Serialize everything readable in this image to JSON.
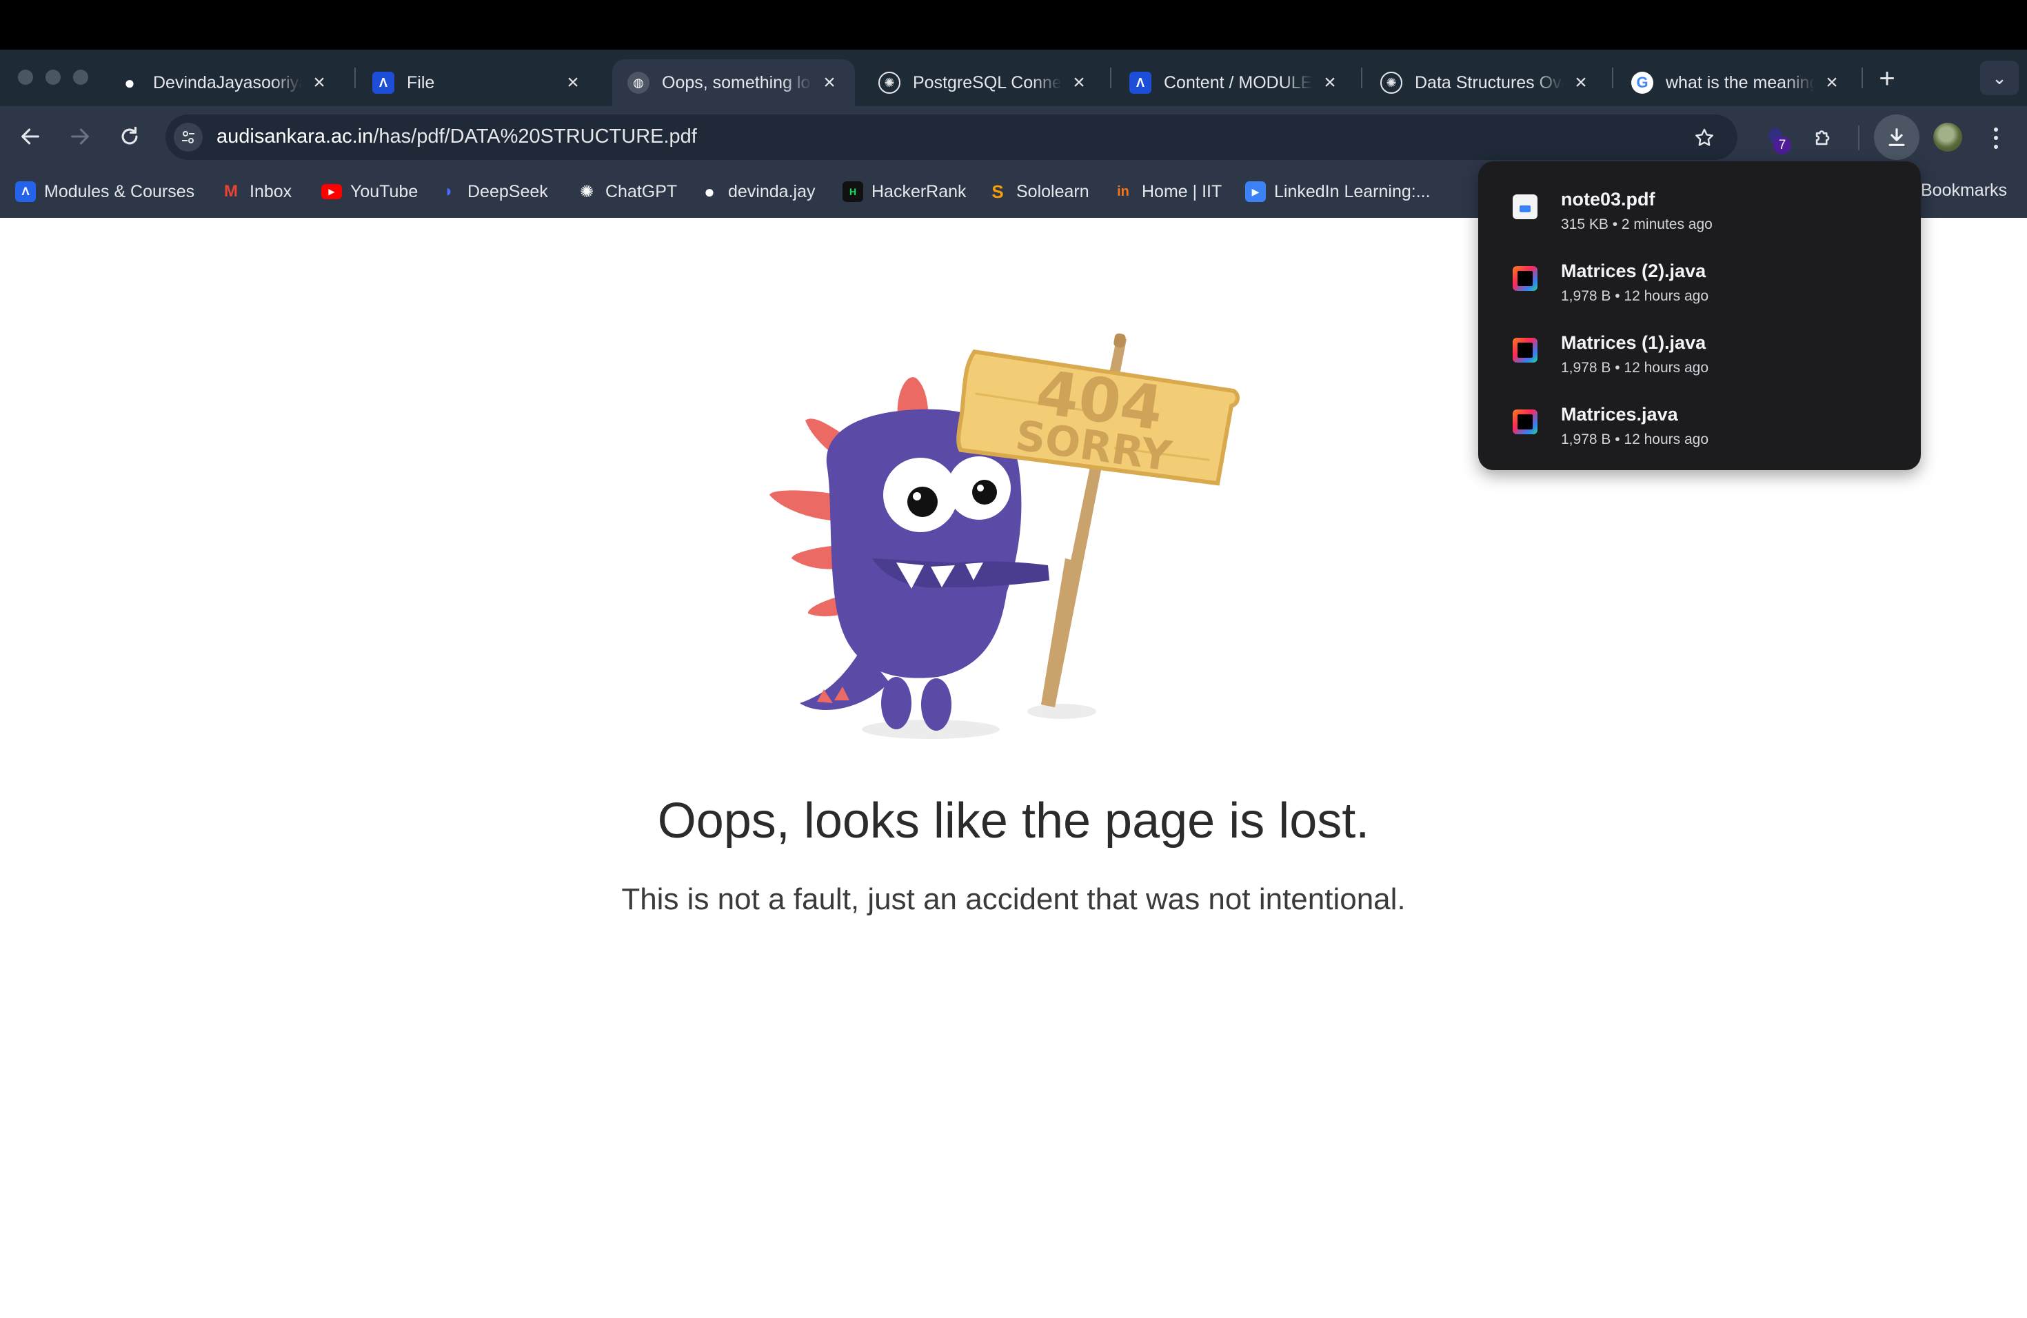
{
  "tabs": [
    {
      "title": "DevindaJayasooriya",
      "icon": "github-icon",
      "active": false
    },
    {
      "title": "File",
      "icon": "a-app-icon",
      "active": false
    },
    {
      "title": "Oops, something lost",
      "icon": "globe-icon",
      "active": true
    },
    {
      "title": "PostgreSQL Connection",
      "icon": "chatgpt-icon",
      "active": false
    },
    {
      "title": "Content / MODULES",
      "icon": "a-app-icon",
      "active": false
    },
    {
      "title": "Data Structures Overview",
      "icon": "chatgpt-icon",
      "active": false
    },
    {
      "title": "what is the meaning",
      "icon": "google-icon",
      "active": false
    }
  ],
  "toolbar": {
    "url_host": "audisankara.ac.in",
    "url_path": "/has/pdf/DATA%20STRUCTURE.pdf",
    "extension_badge": "7"
  },
  "bookmarks": [
    {
      "label": "Modules & Courses",
      "icon": "a-app-icon",
      "color": "#2563eb"
    },
    {
      "label": "Inbox",
      "icon": "gmail-icon",
      "color": "#ea4335"
    },
    {
      "label": "YouTube",
      "icon": "youtube-icon",
      "color": "#ff0000"
    },
    {
      "label": "DeepSeek",
      "icon": "deepseek-icon",
      "color": "#4d6bfe"
    },
    {
      "label": "ChatGPT",
      "icon": "chatgpt-icon",
      "color": "#ffffff"
    },
    {
      "label": "devinda.jay",
      "icon": "github-icon",
      "color": "#ffffff"
    },
    {
      "label": "HackerRank",
      "icon": "hackerrank-icon",
      "color": "#00ea64"
    },
    {
      "label": "Sololearn",
      "icon": "sololearn-icon",
      "color": "#f59e0b"
    },
    {
      "label": "Home | IIT",
      "icon": "iit-icon",
      "color": "#f97316"
    },
    {
      "label": "LinkedIn Learning:...",
      "icon": "linkedin-learning-icon",
      "color": "#3b82f6"
    }
  ],
  "all_bookmarks_label": "Bookmarks",
  "page": {
    "sign_line1": "404",
    "sign_line2": "SORRY",
    "heading": "Oops, looks like the page is lost.",
    "subheading": "This is not a fault, just an accident that was not intentional."
  },
  "downloads": [
    {
      "name": "note03.pdf",
      "meta": "315 KB • 2 minutes ago",
      "type": "pdf"
    },
    {
      "name": "Matrices (2).java",
      "meta": "1,978 B • 12 hours ago",
      "type": "java"
    },
    {
      "name": "Matrices (1).java",
      "meta": "1,978 B • 12 hours ago",
      "type": "java"
    },
    {
      "name": "Matrices.java",
      "meta": "1,978 B • 12 hours ago",
      "type": "java"
    }
  ],
  "colors": {
    "chrome_dark": "#1f2a37",
    "toolbar": "#2d3748",
    "monster_purple": "#5b4aa6",
    "spikes_red": "#ec6a64",
    "sign_yellow": "#f3cd75"
  }
}
